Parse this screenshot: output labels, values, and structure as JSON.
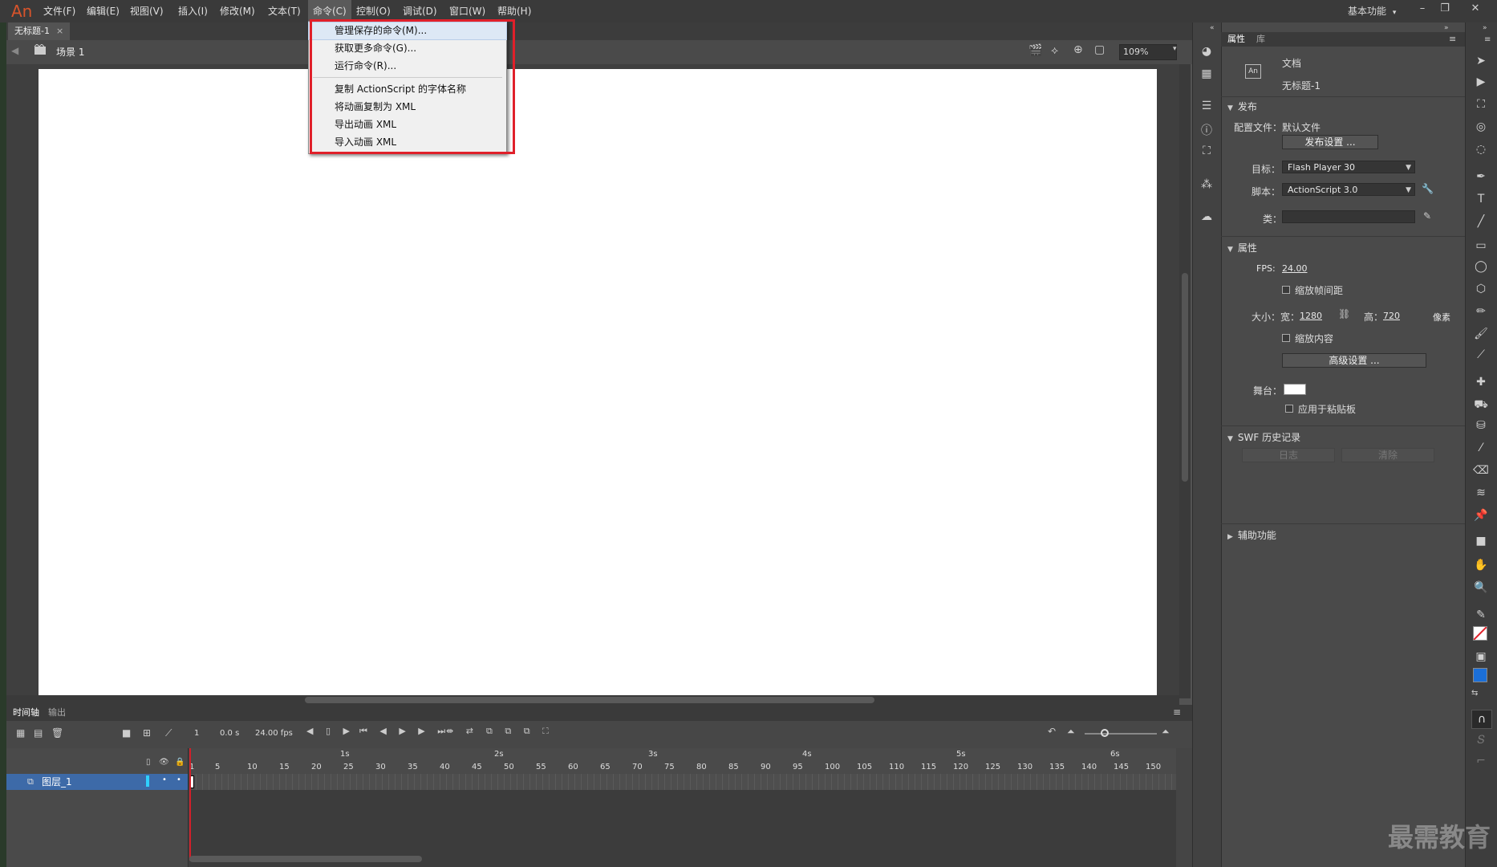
{
  "app": {
    "logo": "An"
  },
  "menubar": {
    "items": [
      "文件(F)",
      "编辑(E)",
      "视图(V)",
      "插入(I)",
      "修改(M)",
      "文本(T)",
      "命令(C)",
      "控制(O)",
      "调试(D)",
      "窗口(W)",
      "帮助(H)"
    ],
    "active": "命令(C)",
    "workspace": "基本功能",
    "workspace_arrow": "▾"
  },
  "window_controls": {
    "minimize": "–",
    "restore": "❐",
    "close": "✕"
  },
  "document_tab": {
    "title": "无标题-1",
    "close": "×"
  },
  "editbar": {
    "scene": "场景 1",
    "zoom": "109%"
  },
  "command_menu": {
    "items": [
      "管理保存的命令(M)...",
      "获取更多命令(G)...",
      "运行命令(R)...",
      "复制 ActionScript 的字体名称",
      "将动画复制为 XML",
      "导出动画 XML",
      "导入动画 XML"
    ],
    "highlighted_index": 0
  },
  "timeline": {
    "tabs": [
      "时间轴",
      "输出"
    ],
    "current_frame": "1",
    "time": "0.0 s",
    "fps": "24.00 fps",
    "layer_name": "图层_1",
    "ruler_seconds": [
      "1s",
      "2s",
      "3s",
      "4s",
      "5s",
      "6s"
    ],
    "ruler_frames": [
      "1",
      "5",
      "10",
      "15",
      "20",
      "25",
      "30",
      "35",
      "40",
      "45",
      "50",
      "55",
      "60",
      "65",
      "70",
      "75",
      "80",
      "85",
      "90",
      "95",
      "100",
      "105",
      "110",
      "115",
      "120",
      "125",
      "130",
      "135",
      "140",
      "145",
      "150"
    ]
  },
  "properties": {
    "tabs": [
      "属性",
      "库"
    ],
    "doc_type": "文档",
    "doc_name": "无标题-1",
    "doc_icon": "An",
    "publish": {
      "header": "发布",
      "profile_label": "配置文件：",
      "profile_value": "默认文件",
      "settings_button": "发布设置 ...",
      "target_label": "目标：",
      "target_value": "Flash Player 30",
      "script_label": "脚本：",
      "script_value": "ActionScript 3.0",
      "class_label": "类："
    },
    "attributes": {
      "header": "属性",
      "fps_label": "FPS:",
      "fps_value": "24.00",
      "scale_frames": "缩放帧间距",
      "size_label": "大小：",
      "width_label": "宽：",
      "width_value": "1280",
      "height_label": "高：",
      "height_value": "720",
      "unit": "像素",
      "scale_content": "缩放内容",
      "advanced_button": "高级设置 ...",
      "stage_label": "舞台：",
      "stage_color": "#ffffff",
      "apply_pasteboard": "应用于粘贴板"
    },
    "swf_history": {
      "header": "SWF 历史记录",
      "log_button": "日志",
      "clear_button": "清除"
    },
    "accessibility": {
      "header": "辅助功能"
    }
  },
  "watermark": "最需教育",
  "colors": {
    "accent_red": "#e0202a",
    "layer_blue": "#3d6aa8",
    "fill_blue": "#1b6fd8"
  }
}
